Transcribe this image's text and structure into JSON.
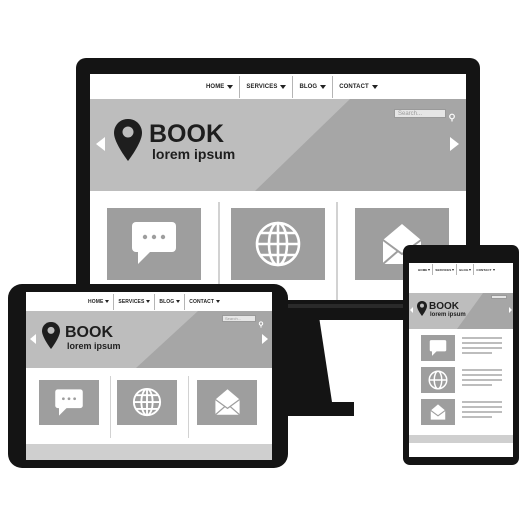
{
  "nav": {
    "home": "HOME",
    "services": "SERVICES",
    "blog": "BLOG",
    "contact": "CONTACT"
  },
  "search": {
    "placeholder": "Search..."
  },
  "hero": {
    "title": "BOOK",
    "subtitle": "lorem ipsum"
  },
  "icons": {
    "logo": "location-pin-icon",
    "tile_1": "chat-bubble-icon",
    "tile_2": "globe-icon",
    "tile_3": "envelope-icon"
  },
  "colors": {
    "device": "#141414",
    "hero": "#bdbdbd",
    "hero_shade": "#a6a6a6",
    "tile": "#9e9e9e",
    "text": "#1e1e1e"
  }
}
